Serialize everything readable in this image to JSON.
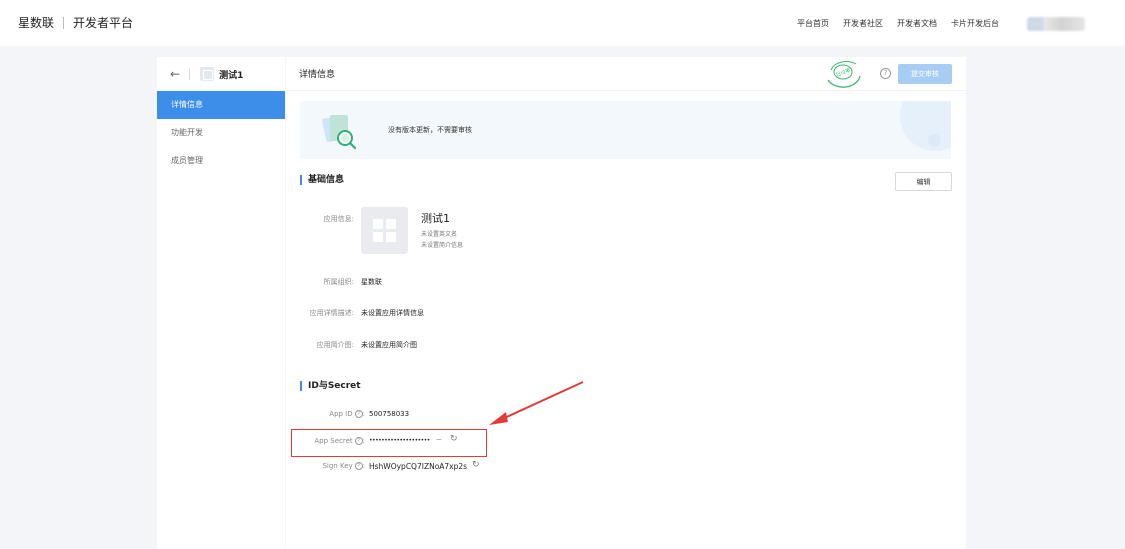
{
  "topbar": {
    "brand": "星数联",
    "platform": "开发者平台",
    "nav": [
      "平台首页",
      "开发者社区",
      "开发者文档",
      "卡片开发后台"
    ]
  },
  "sidebar": {
    "app_name": "测试1",
    "items": [
      "详情信息",
      "功能开发",
      "成员管理"
    ]
  },
  "main": {
    "title": "详情信息",
    "stamp_text": "已过审",
    "help_icon": "?",
    "submit_label": "提交审核",
    "notice": "没有版本更新，不需要审核",
    "basic_info": {
      "title": "基础信息",
      "edit_label": "编辑",
      "app_info_label": "应用信息:",
      "app_name": "测试1",
      "english_name": "未设置英文名",
      "intro": "未设置简介信息",
      "org_label": "所属组织:",
      "org_value": "星数联",
      "desc_label": "应用详情描述:",
      "desc_value": "未设置应用详情信息",
      "image_label": "应用简介图:",
      "image_value": "未设置应用简介图"
    },
    "id_secret": {
      "title": "ID与Secret",
      "app_id_label": "App ID",
      "app_id_value": "500758033",
      "app_secret_label": "App Secret",
      "app_secret_value": "••••••••••••••••••••",
      "sign_key_label": "Sign Key",
      "sign_key_value": "HshWOypCQ7IZNoA7xp2s",
      "colon": ":"
    }
  },
  "icons": {
    "back": "arrow-left-icon",
    "eye": "eye-closed-icon",
    "refresh": "refresh-icon"
  },
  "colors": {
    "accent": "#3d8ee8",
    "highlight": "#e23b3b",
    "stamp": "#3bb56b"
  }
}
